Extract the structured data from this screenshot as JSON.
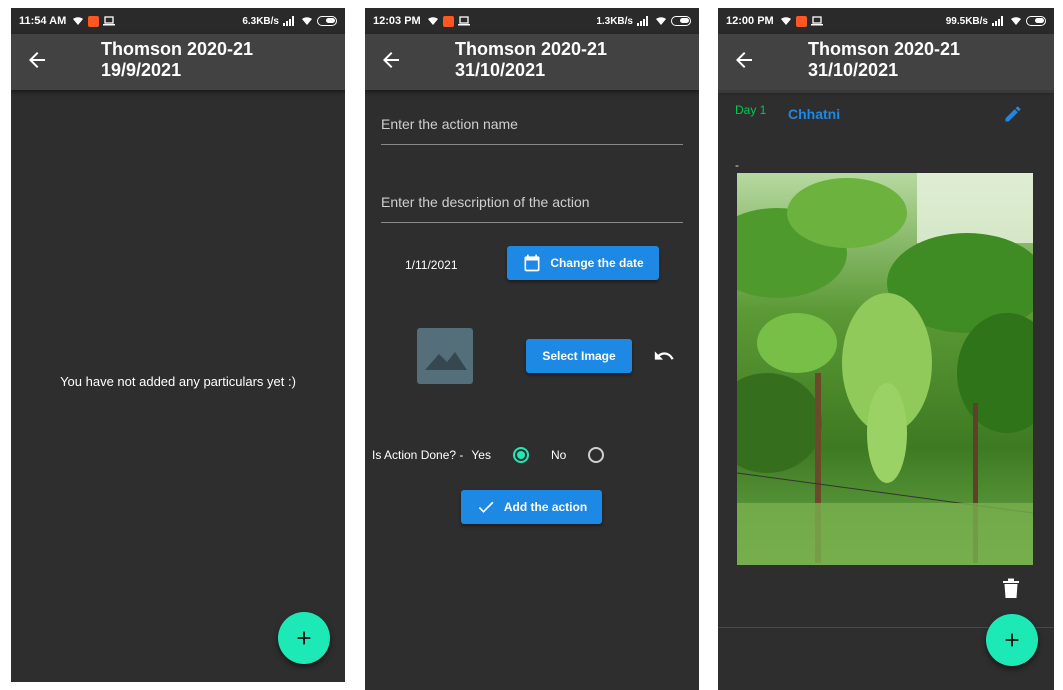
{
  "screens": [
    {
      "status": {
        "time": "11:54 AM",
        "speed": "6.3KB/s"
      },
      "appbar": {
        "title_line1": "Thomson 2020-21",
        "title_line2": "19/9/2021"
      },
      "empty_message": "You have not added any particulars yet :)",
      "fab_icon": "plus-icon"
    },
    {
      "status": {
        "time": "12:03 PM",
        "speed": "1.3KB/s"
      },
      "appbar": {
        "title_line1": "Thomson 2020-21",
        "title_line2": "31/10/2021"
      },
      "form": {
        "action_name_placeholder": "Enter the action name",
        "description_placeholder": "Enter the description of the action",
        "date_value": "1/11/2021",
        "change_date_label": "Change the date",
        "select_image_label": "Select Image",
        "is_done_label": "Is Action Done? -",
        "yes_label": "Yes",
        "no_label": "No",
        "is_done_selected": "Yes",
        "add_action_label": "Add the action"
      }
    },
    {
      "status": {
        "time": "12:00 PM",
        "speed": "99.5KB/s"
      },
      "appbar": {
        "title_line1": "Thomson 2020-21",
        "title_line2": "31/10/2021"
      },
      "entry": {
        "day_label": "Day 1",
        "action_name": "Chhatni",
        "description": "-"
      },
      "fab_icon": "plus-icon"
    }
  ],
  "colors": {
    "background": "#2e2e2e",
    "appbar": "#424242",
    "accent_teal": "#1de9b6",
    "button_blue": "#1e88e5",
    "day_green": "#00c853"
  }
}
